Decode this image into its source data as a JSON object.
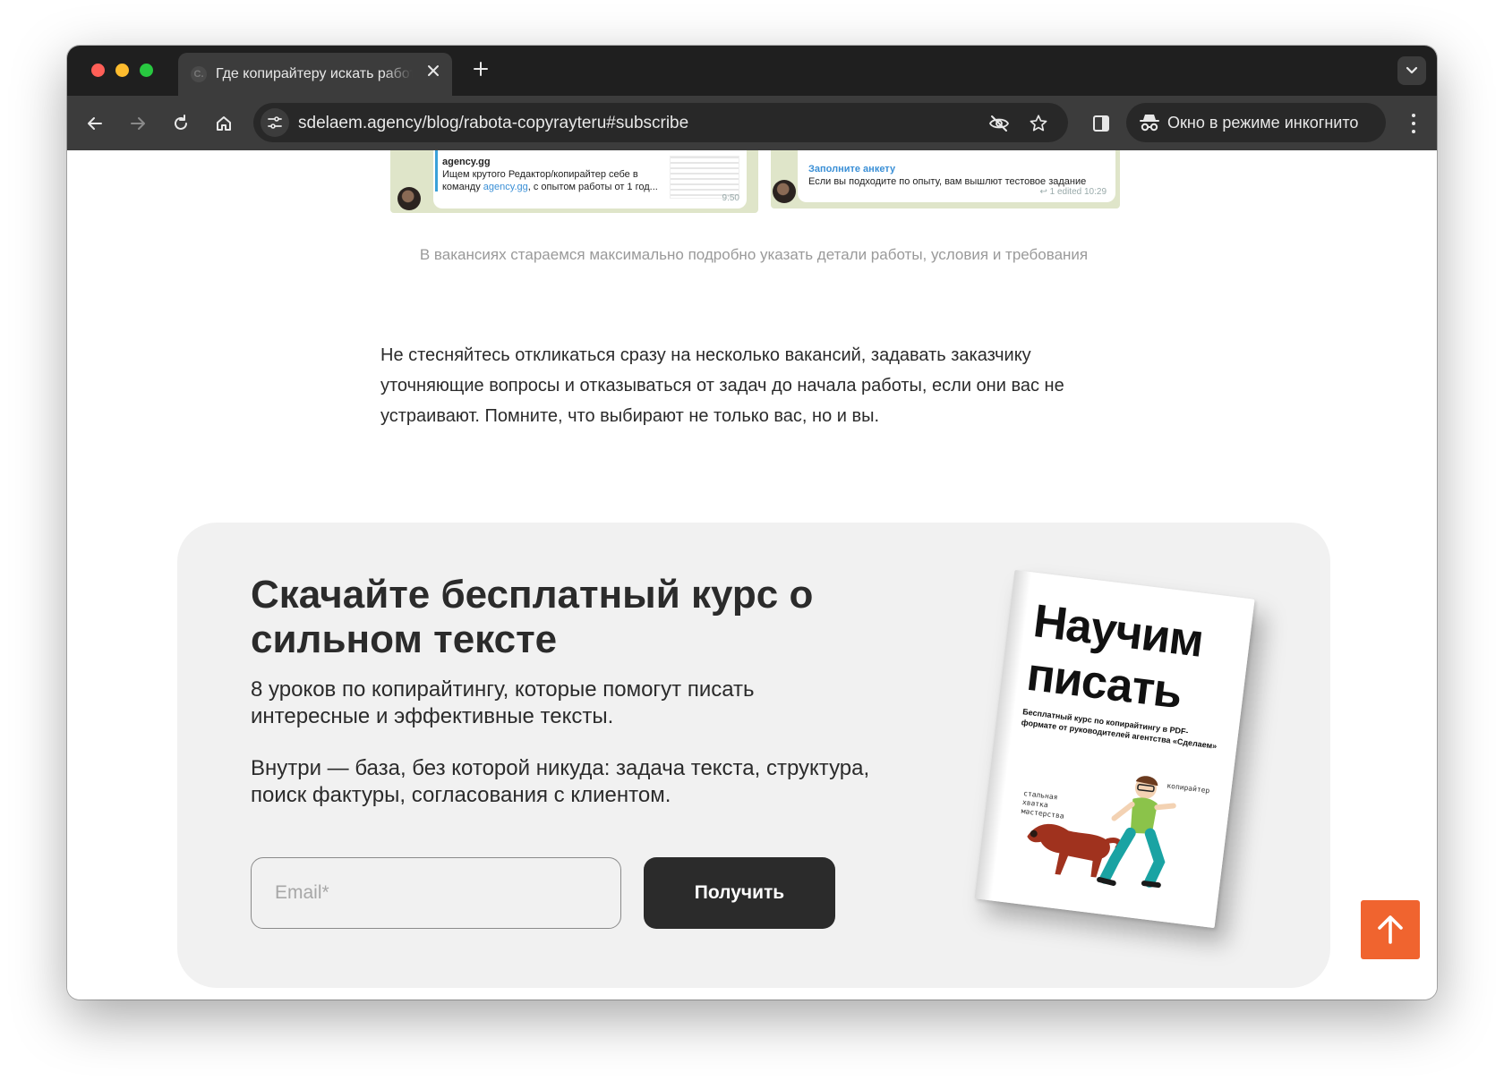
{
  "browser": {
    "tab_title": "Где копирайтеру искать работу",
    "tab_favicon": "C.",
    "url": "sdelaem.agency/blog/rabota-copyrayteru#subscribe",
    "incognito_label": "Окно в режиме инкогнито",
    "icons": [
      "back-icon",
      "forward-icon",
      "reload-icon",
      "home-icon",
      "site-info-icon",
      "eye-off-icon",
      "star-icon",
      "side-panel-icon",
      "incognito-icon",
      "menu-icon",
      "chevron-down-icon",
      "close-icon",
      "plus-icon"
    ]
  },
  "screenshots": {
    "left": {
      "sender": "agency.gg",
      "line1_start": "Ищем крутого",
      "line1_end": "Редактор/копирайтер себе в",
      "line2_prefix": "команду",
      "line2_link": "agency.gg",
      "line2_rest": ", с опытом работы от 1 год...",
      "time": "9:50"
    },
    "right": {
      "link": "Заполните анкету",
      "text": "Если вы подходите по опыту, вам вышлют тестовое задание",
      "edited": "↩ 1   edited 10:29"
    }
  },
  "article": {
    "caption": "В вакансиях стараемся максимально подробно указать детали работы, условия и требования",
    "paragraph": "Не стесняйтесь откликаться сразу на несколько вакансий, задавать заказчику уточняющие вопросы и отказываться от задач до начала работы, если они вас не устраивают. Помните, что выбирают не только вас, но и вы."
  },
  "subscribe": {
    "title": "Скачайте бесплатный курс о сильном тексте",
    "description": "8 уроков по копирайтингу, которые помогут писать интересные и эффективные тексты.",
    "description2": "Внутри — база, без которой никуда: задача текста, структура, поиск фактуры, согласования с клиентом.",
    "email_placeholder": "Email*",
    "button_label": "Получить",
    "book": {
      "title": "Научим писать",
      "subtitle": "Бесплатный курс по копирайтингу в PDF-формате от руководителей агентства «Сделаем»",
      "note_right": "копирайтер",
      "note_left": "стальная хватка мастерства"
    }
  },
  "colors": {
    "accent": "#f0642f",
    "dark": "#2b2b2b",
    "panel": "#f1f1f1"
  }
}
